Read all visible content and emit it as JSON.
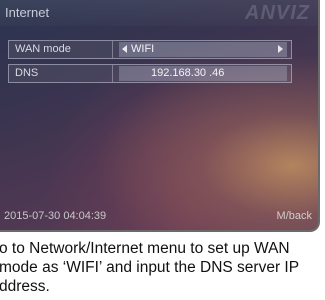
{
  "screen": {
    "title": "Internet",
    "brand": "ANVIZ",
    "rows": [
      {
        "label": "WAN mode",
        "value": "WIFI"
      },
      {
        "label": "DNS",
        "value": "192.168.30 .46"
      }
    ],
    "footer": {
      "timestamp": "2015-07-30 04:04:39",
      "back_hint": "M/back"
    }
  },
  "caption": "o to Network/Internet menu to set up WAN mode as ‘WIFI’ and input the DNS server IP ddress."
}
